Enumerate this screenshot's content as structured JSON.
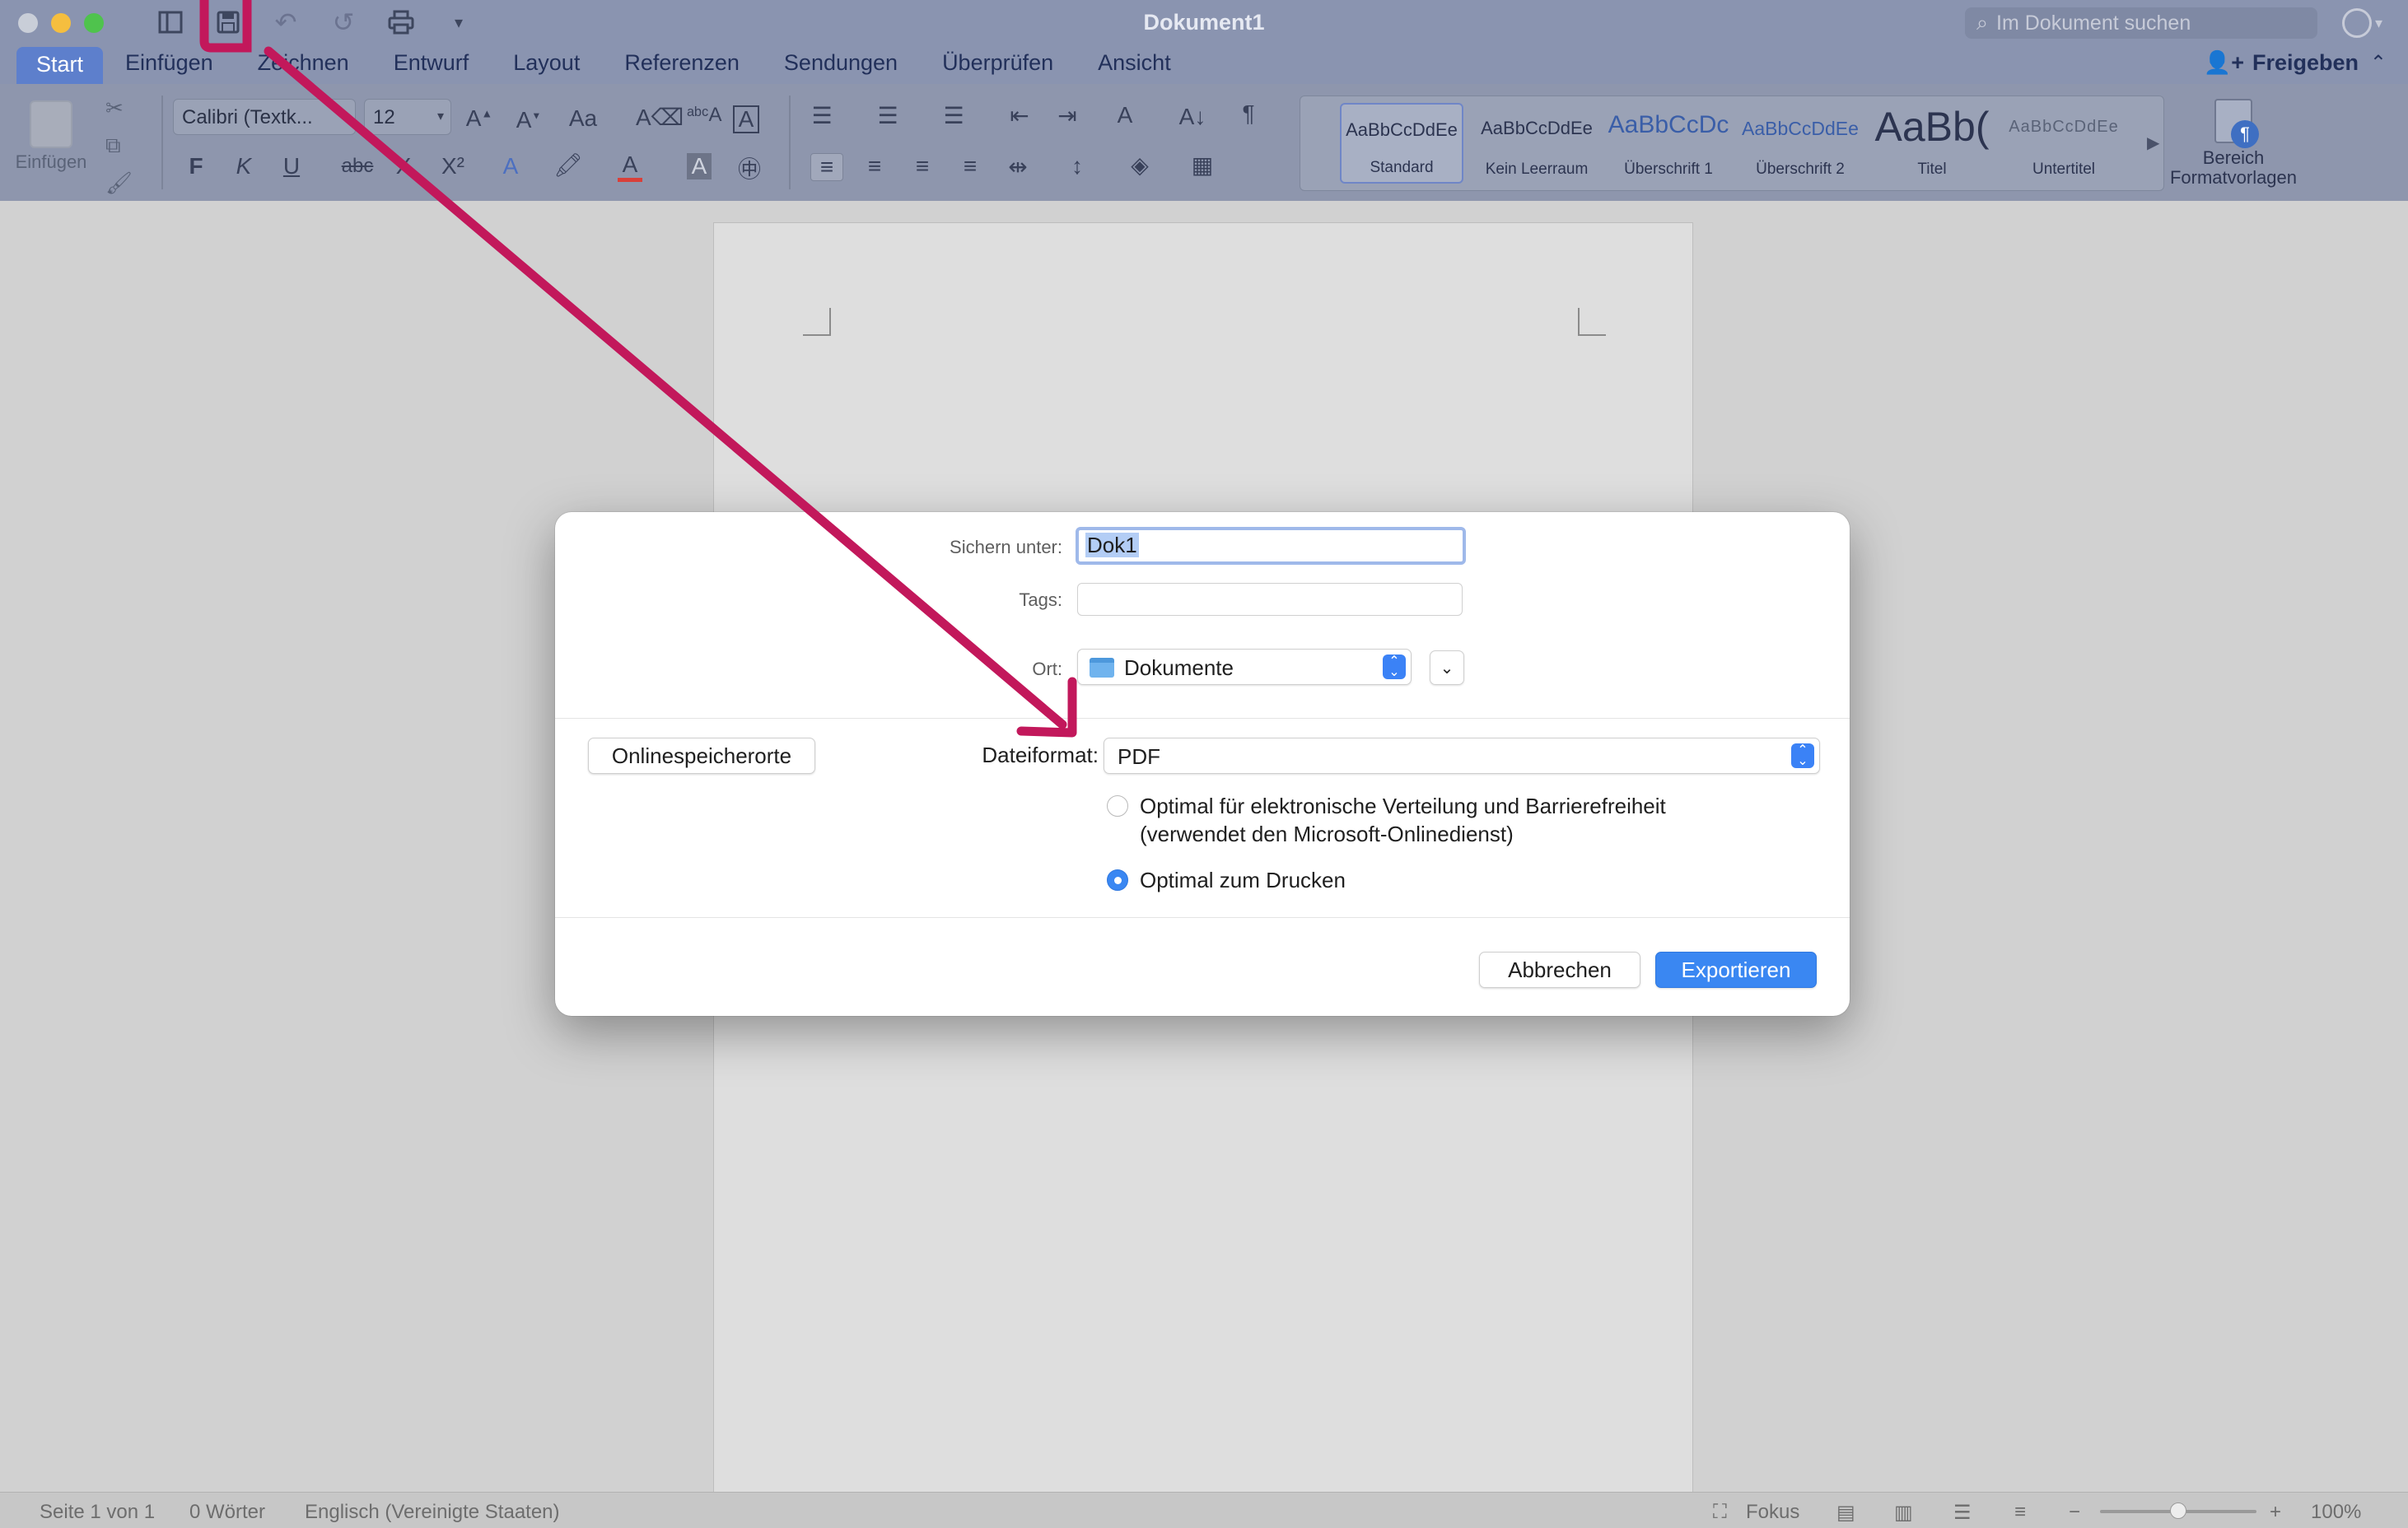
{
  "window": {
    "title": "Dokument1",
    "search_placeholder": "Im Dokument suchen"
  },
  "colors": {
    "accent": "#3a87f2",
    "annotation": "#c2185b",
    "tab_active": "#5d7fcc"
  },
  "ribbon": {
    "tabs": [
      {
        "label": "Start",
        "active": true
      },
      {
        "label": "Einfügen"
      },
      {
        "label": "Zeichnen"
      },
      {
        "label": "Entwurf"
      },
      {
        "label": "Layout"
      },
      {
        "label": "Referenzen"
      },
      {
        "label": "Sendungen"
      },
      {
        "label": "Überprüfen"
      },
      {
        "label": "Ansicht"
      }
    ],
    "share_label": "Freigeben",
    "paste_label": "Einfügen",
    "font_name": "Calibri (Textk...",
    "font_size": "12",
    "format_buttons": {
      "bold": "F",
      "italic": "K",
      "underline": "U",
      "strikethrough": "abc",
      "subscript": "X",
      "superscript": "X²"
    },
    "styles": [
      {
        "sample": "AaBbCcDdEe",
        "name": "Standard",
        "active": true
      },
      {
        "sample": "AaBbCcDdEe",
        "name": "Kein Leerraum"
      },
      {
        "sample": "AaBbCcDc",
        "name": "Überschrift 1"
      },
      {
        "sample": "AaBbCcDdEe",
        "name": "Überschrift 2"
      },
      {
        "sample": "AaBb(",
        "name": "Titel"
      },
      {
        "sample": "AaBbCcDdEe",
        "name": "Untertitel"
      }
    ],
    "styles_pane_label": "Bereich Formatvorlagen"
  },
  "dialog": {
    "save_as_label": "Sichern unter:",
    "save_as_value": "Dok1",
    "tags_label": "Tags:",
    "tags_value": "",
    "location_label": "Ort:",
    "location_value": "Dokumente",
    "online_locations_button": "Onlinespeicherorte",
    "file_format_label": "Dateiformat:",
    "file_format_value": "PDF",
    "options": [
      {
        "label": "Optimal für elektronische Verteilung und Barrierefreiheit",
        "sublabel": "(verwendet den Microsoft-Onlinedienst)",
        "selected": false
      },
      {
        "label": "Optimal zum Drucken",
        "selected": true
      }
    ],
    "cancel_button": "Abbrechen",
    "export_button": "Exportieren"
  },
  "statusbar": {
    "page": "Seite 1 von 1",
    "words": "0 Wörter",
    "language": "Englisch (Vereinigte Staaten)",
    "focus": "Fokus",
    "zoom": "100%",
    "zoom_percent": 100
  }
}
